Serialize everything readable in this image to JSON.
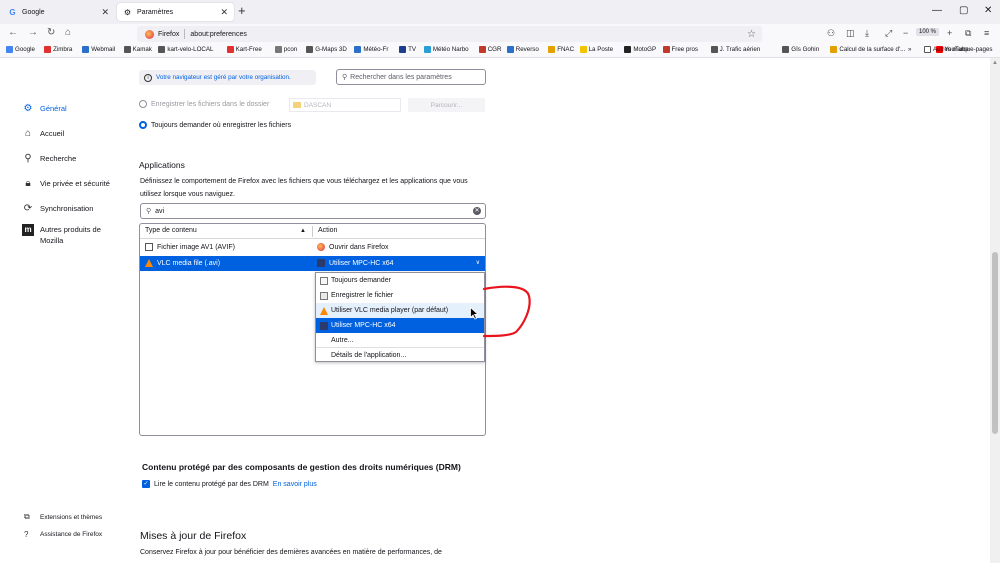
{
  "tabs": [
    {
      "title": "Google",
      "icon": "G",
      "active": false
    },
    {
      "title": "Paramètres",
      "icon": "gear",
      "active": true
    }
  ],
  "window_controls": [
    "—",
    "▢",
    "✕"
  ],
  "navbar": {
    "browser_label": "Firefox",
    "url": "about:preferences",
    "zoom": "100 %"
  },
  "bookmarks": [
    {
      "label": "Google",
      "color": "#4285f4"
    },
    {
      "label": "Zimbra",
      "color": "#e03030"
    },
    {
      "label": "Webmail",
      "color": "#2a6fc9"
    },
    {
      "label": "Kamak",
      "color": "#555555"
    },
    {
      "label": "kart-velo-LOCAL",
      "color": "#555555"
    },
    {
      "label": "Kart-Free",
      "color": "#e03030"
    },
    {
      "label": "pcon",
      "color": "#777777"
    },
    {
      "label": "G-Maps 3D",
      "color": "#555555"
    },
    {
      "label": "Météo-Fr",
      "color": "#2a6fc9"
    },
    {
      "label": "TV",
      "color": "#1a3f8f"
    },
    {
      "label": "Météo Narbo",
      "color": "#2a9fd6"
    },
    {
      "label": "CGR",
      "color": "#c0392b"
    },
    {
      "label": "Reverso",
      "color": "#2a6fc9"
    },
    {
      "label": "FNAC",
      "color": "#e2a100"
    },
    {
      "label": "La Poste",
      "color": "#f2c500"
    },
    {
      "label": "MotoGP",
      "color": "#222222"
    },
    {
      "label": "Free pros",
      "color": "#c0392b"
    },
    {
      "label": "J. Trafic aérien",
      "color": "#555555"
    },
    {
      "label": "Gîs Gohin",
      "color": "#555555"
    },
    {
      "label": "Calcul de la surface d'...",
      "color": "#e2a100"
    },
    {
      "label": "YouTube",
      "color": "#ff0000"
    }
  ],
  "bookmarks_overflow": "»",
  "other_bookmarks": "Autres marque-pages",
  "sidebar": {
    "items": [
      {
        "label": "Général",
        "icon": "gear-icon",
        "active": true
      },
      {
        "label": "Accueil",
        "icon": "home-icon",
        "active": false
      },
      {
        "label": "Recherche",
        "icon": "search-icon",
        "active": false
      },
      {
        "label": "Vie privée et sécurité",
        "icon": "lock-icon",
        "active": false
      },
      {
        "label": "Synchronisation",
        "icon": "sync-icon",
        "active": false
      },
      {
        "label": "Autres produits de Mozilla",
        "icon": "mozilla-icon",
        "active": false
      }
    ],
    "bottom": [
      {
        "label": "Extensions et thèmes",
        "icon": "puzzle-icon"
      },
      {
        "label": "Assistance de Firefox",
        "icon": "help-icon"
      }
    ]
  },
  "managed_notice": "Votre navigateur est géré par votre organisation.",
  "search_prefs_placeholder": "Rechercher dans les paramètres",
  "downloads": {
    "save_option": "Enregistrer les fichiers dans le dossier",
    "folder": "DASCAN",
    "browse": "Parcourir...",
    "ask_option": "Toujours demander où enregistrer les fichiers"
  },
  "applications": {
    "title": "Applications",
    "desc": "Définissez le comportement de Firefox avec les fichiers que vous téléchargez et les applications que vous utilisez lorsque vous naviguez.",
    "search_value": "avi",
    "col_type": "Type de contenu",
    "col_action": "Action",
    "rows": [
      {
        "type": "Fichier image AV1 (AVIF)",
        "action": "Ouvrir dans Firefox"
      },
      {
        "type": "VLC media file (.avi)",
        "action": "Utiliser MPC-HC x64"
      }
    ],
    "dropdown": [
      "Toujours demander",
      "Enregistrer le fichier",
      "Utiliser VLC media player (par défaut)",
      "Utiliser MPC-HC x64",
      "Autre...",
      "Détails de l'application..."
    ]
  },
  "drm": {
    "title": "Contenu protégé par des composants de gestion des droits numériques (DRM)",
    "checkbox": "Lire le contenu protégé par des DRM",
    "link": "En savoir plus"
  },
  "updates": {
    "title": "Mises à jour de Firefox",
    "desc": "Conservez Firefox à jour pour bénéficier des dernières avancées en matière de performances, de"
  },
  "annotation_color": "#e8141e"
}
